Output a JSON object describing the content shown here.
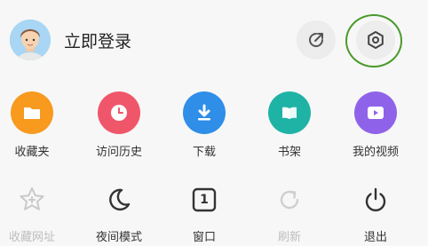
{
  "header": {
    "login_label": "立即登录"
  },
  "quick_actions": [
    {
      "label": "收藏夹",
      "color": "#f79a1e"
    },
    {
      "label": "访问历史",
      "color": "#f0566a"
    },
    {
      "label": "下载",
      "color": "#2e8ee8"
    },
    {
      "label": "书架",
      "color": "#1fb3a6"
    },
    {
      "label": "我的视频",
      "color": "#8f63e9"
    }
  ],
  "tools": [
    {
      "label": "收藏网址",
      "enabled": false
    },
    {
      "label": "夜间模式",
      "enabled": true
    },
    {
      "label": "窗口",
      "enabled": true,
      "badge": "1"
    },
    {
      "label": "刷新",
      "enabled": false
    },
    {
      "label": "退出",
      "enabled": true
    }
  ],
  "colors": {
    "highlight_ring": "#4a9a2a",
    "disabled_text": "#bdbdbd"
  }
}
